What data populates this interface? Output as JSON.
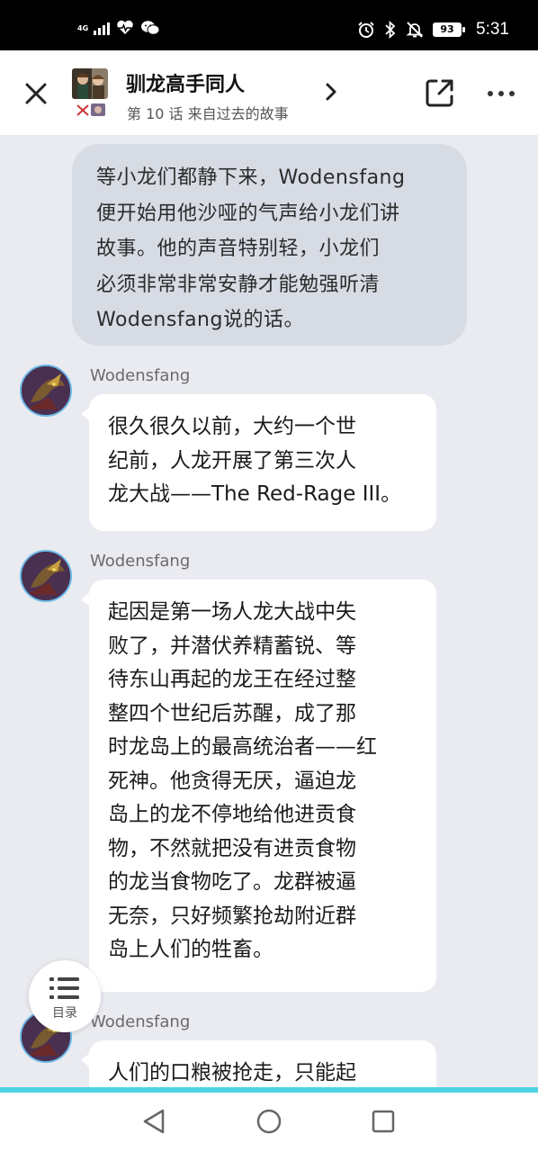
{
  "status_bar": {
    "network": "4G",
    "battery": "93",
    "time": "5:31"
  },
  "header": {
    "title": "驯龙高手同人",
    "subtitle": "第 10 话 来自过去的故事"
  },
  "narration": {
    "lines": [
      "等小龙们都静下来，Wodensfang",
      "便开始用他沙哑的气声给小龙们讲",
      "故事。他的声音特别轻，小龙们",
      "必须非常非常安静才能勉强听清",
      "Wodensfang说的话。"
    ]
  },
  "messages": [
    {
      "sender": "Wodensfang",
      "lines": [
        "很久很久以前，大约一个世",
        "纪前，人龙开展了第三次人",
        "龙大战——The Red-Rage III。"
      ]
    },
    {
      "sender": "Wodensfang",
      "lines": [
        "起因是第一场人龙大战中失",
        "败了，并潜伏养精蓄锐、等",
        "待东山再起的龙王在经过整",
        "整四个世纪后苏醒，成了那",
        "时龙岛上的最高统治者——红",
        "死神。他贪得无厌，逼迫龙",
        "岛上的龙不停地给他进贡食",
        "物，不然就把没有进贡食物",
        "的龙当食物吃了。龙群被逼",
        "无奈，只好频繁抢劫附近群",
        "岛上人们的牲畜。"
      ]
    },
    {
      "sender": "Wodensfang",
      "lines": [
        "人们的口粮被抢走，只能起"
      ]
    }
  ],
  "toc": {
    "label": "目录"
  },
  "colors": {
    "accent_bar": "#4fd2e2",
    "avatar_ring": "#6cb8e8",
    "narration_bg": "#d7dbe4",
    "page_bg": "#e9ebf0"
  },
  "icons": [
    "signal-icon",
    "heartbeat-icon",
    "wechat-icon",
    "alarm-icon",
    "bluetooth-icon",
    "mute-bell-icon",
    "close-icon",
    "chevron-right-icon",
    "share-icon",
    "more-icon",
    "list-icon",
    "back-icon",
    "home-icon",
    "recent-apps-icon"
  ]
}
